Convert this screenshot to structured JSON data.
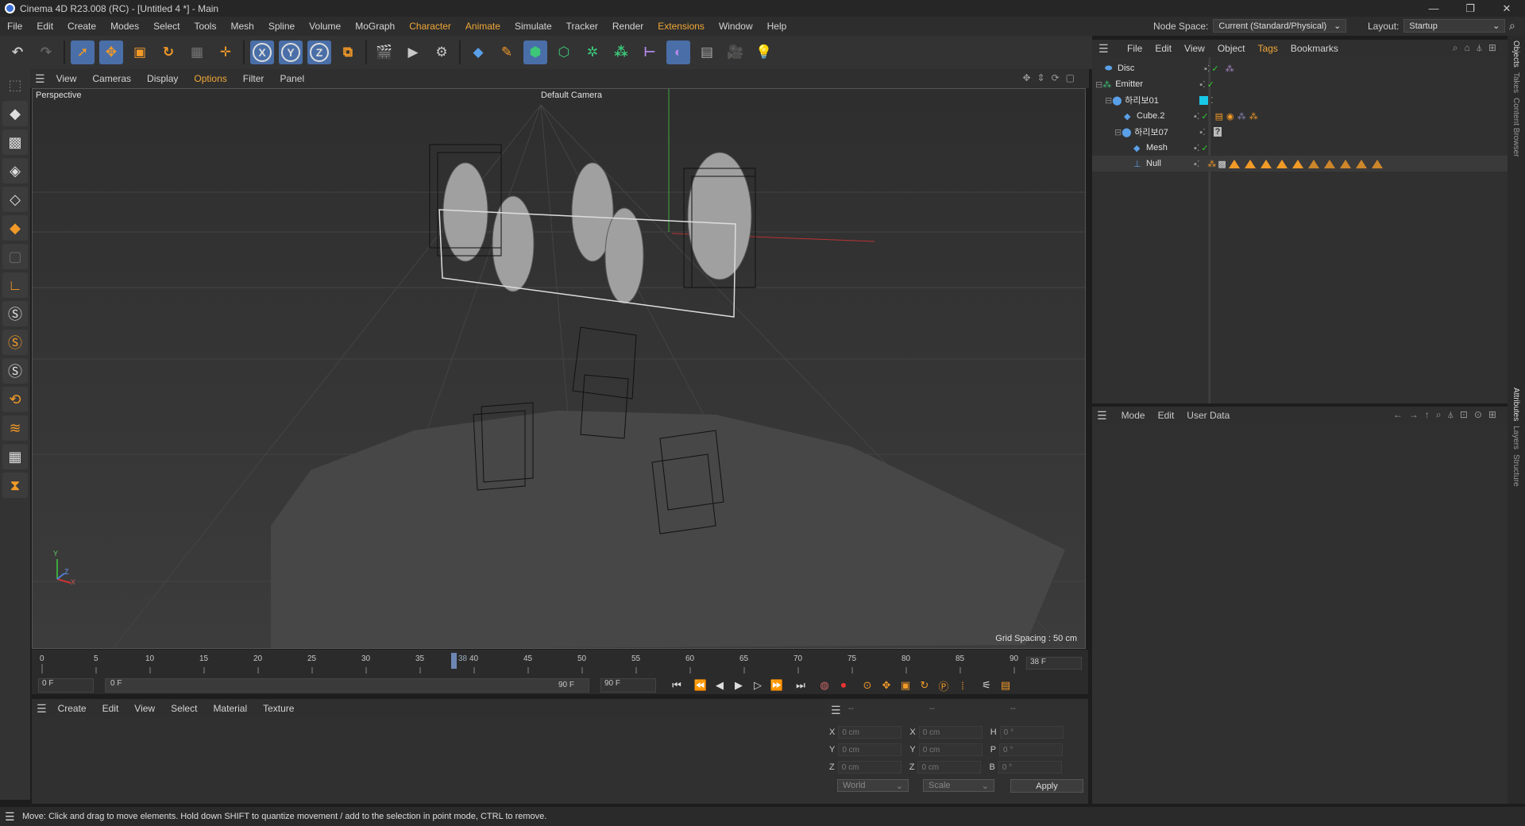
{
  "window": {
    "title": "Cinema 4D R23.008 (RC) - [Untitled 4 *] - Main",
    "controls": [
      "—",
      "❐",
      "✕"
    ]
  },
  "menubar": {
    "items": [
      "File",
      "Edit",
      "Create",
      "Modes",
      "Select",
      "Tools",
      "Mesh",
      "Spline",
      "Volume",
      "MoGraph",
      "Character",
      "Animate",
      "Simulate",
      "Tracker",
      "Render",
      "Extensions",
      "Window",
      "Help"
    ],
    "node_space_label": "Node Space:",
    "node_space_value": "Current (Standard/Physical)",
    "layout_label": "Layout:",
    "layout_value": "Startup"
  },
  "toolbar": {
    "axis_x": "X",
    "axis_y": "Y",
    "axis_z": "Z"
  },
  "viewport": {
    "menu": [
      "View",
      "Cameras",
      "Display",
      "Options",
      "Filter",
      "Panel"
    ],
    "view_name": "Perspective",
    "camera": "Default Camera",
    "grid_spacing": "Grid Spacing : 50 cm",
    "axis_y": "Y",
    "axis_x": "X",
    "axis_z": "Z"
  },
  "timeline": {
    "ticks": [
      "0",
      "5",
      "10",
      "15",
      "20",
      "25",
      "30",
      "35",
      "40",
      "45",
      "50",
      "55",
      "60",
      "65",
      "70",
      "75",
      "80",
      "85",
      "90"
    ],
    "current": "38",
    "current_field": "38 F"
  },
  "playbar": {
    "start": "0 F",
    "range_start": "0 F",
    "range_end": "90 F",
    "end": "90 F"
  },
  "material": {
    "menu": [
      "Create",
      "Edit",
      "View",
      "Select",
      "Material",
      "Texture"
    ]
  },
  "coords": {
    "headers": [
      "--",
      "--",
      "--"
    ],
    "rows": [
      {
        "a": "X",
        "av": "0 cm",
        "b": "X",
        "bv": "0 cm",
        "c": "H",
        "cv": "0 °"
      },
      {
        "a": "Y",
        "av": "0 cm",
        "b": "Y",
        "bv": "0 cm",
        "c": "P",
        "cv": "0 °"
      },
      {
        "a": "Z",
        "av": "0 cm",
        "b": "Z",
        "bv": "0 cm",
        "c": "B",
        "cv": "0 °"
      }
    ],
    "space": "World",
    "mode": "Scale",
    "apply": "Apply"
  },
  "objects": {
    "menu": [
      "File",
      "Edit",
      "View",
      "Object",
      "Tags",
      "Bookmarks"
    ],
    "items": [
      {
        "name": "Disc"
      },
      {
        "name": "Emitter"
      },
      {
        "name": "하리보01"
      },
      {
        "name": "Cube.2"
      },
      {
        "name": "하리보07"
      },
      {
        "name": "Mesh"
      },
      {
        "name": "Null"
      }
    ]
  },
  "attributes": {
    "menu": [
      "Mode",
      "Edit",
      "User Data"
    ]
  },
  "side_tabs": [
    "Objects",
    "Takes",
    "Content Browser",
    "Attributes",
    "Layers",
    "Structure"
  ],
  "status": "Move: Click and drag to move elements. Hold down SHIFT to quantize movement / add to the selection in point mode, CTRL to remove."
}
